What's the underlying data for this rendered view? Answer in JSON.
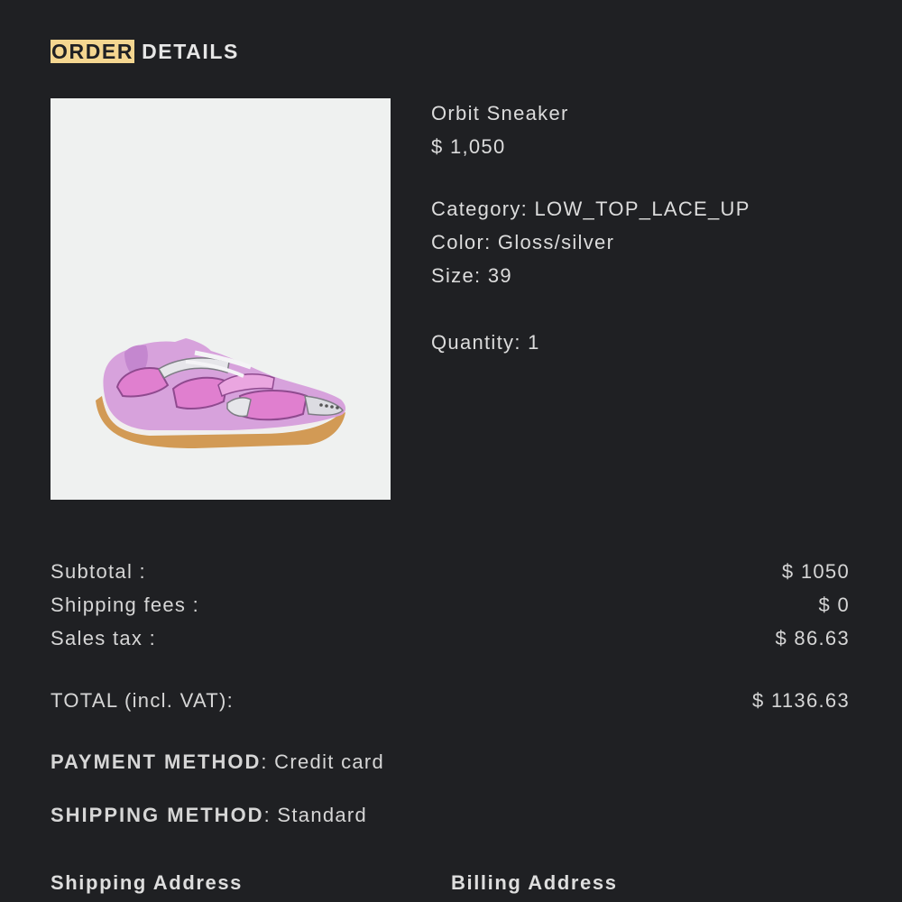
{
  "header": {
    "title_highlight": "ORDER",
    "title_rest": "DETAILS"
  },
  "product": {
    "image_alt": "Orbit Sneaker pink and silver low-top sneaker",
    "name": "Orbit Sneaker",
    "price": "$ 1,050",
    "category_label": "Category:",
    "category": "LOW_TOP_LACE_UP",
    "color_label": "Color:",
    "color": "Gloss/silver",
    "size_label": "Size:",
    "size": "39",
    "quantity_label": "Quantity:",
    "quantity": "1"
  },
  "summary": {
    "subtotal_label": "Subtotal :",
    "subtotal_value": "$ 1050",
    "shipping_label": "Shipping fees :",
    "shipping_value": "$ 0",
    "tax_label": "Sales tax :",
    "tax_value": "$ 86.63",
    "total_label": "TOTAL (incl. VAT):",
    "total_value": "$ 1136.63"
  },
  "payment": {
    "label": "PAYMENT METHOD",
    "value": ": Credit card"
  },
  "shipping_method": {
    "label": "SHIPPING METHOD",
    "value": ": Standard"
  },
  "addresses": {
    "shipping_heading": "Shipping Address",
    "billing_heading": "Billing Address"
  },
  "colors": {
    "background": "#1f2023",
    "highlight": "#f4d690",
    "image_background": "#eff1f0"
  }
}
